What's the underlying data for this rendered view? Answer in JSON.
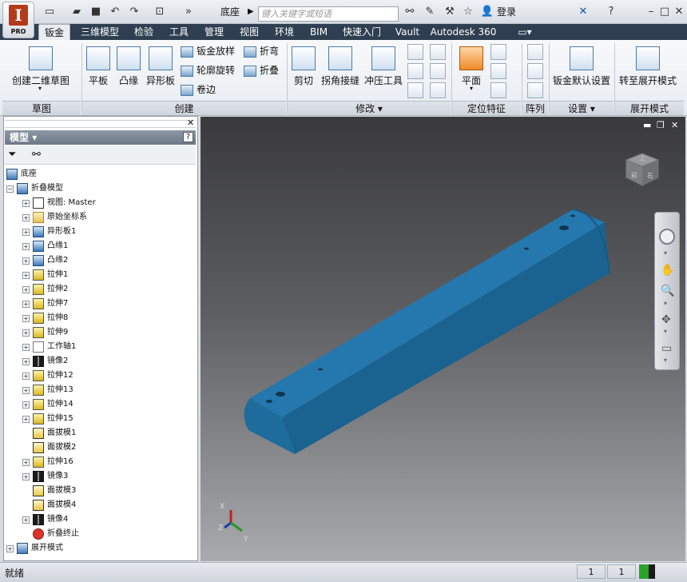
{
  "app": {
    "badge": "PRO",
    "logo_letter": "I"
  },
  "title_bar": {
    "document_name": "底座",
    "search_placeholder": "键入关键字或短语",
    "login_label": "登录"
  },
  "tabs": [
    {
      "label": "钣金",
      "active": true
    },
    {
      "label": "三维模型"
    },
    {
      "label": "检验"
    },
    {
      "label": "工具"
    },
    {
      "label": "管理"
    },
    {
      "label": "视图"
    },
    {
      "label": "环境"
    },
    {
      "label": "BIM"
    },
    {
      "label": "快速入门"
    },
    {
      "label": "Vault"
    },
    {
      "label": "Autodesk 360"
    }
  ],
  "ribbon": {
    "sketch": {
      "title": "草图",
      "create_sketch": "创建二维草图"
    },
    "create": {
      "title": "创建",
      "face": "平板",
      "flange": "凸缘",
      "contour_flange": "异形板",
      "lofted_flange": "钣金放样",
      "contour_roll": "轮廓旋转",
      "hem": "卷边",
      "fold": "折弯",
      "fold2": "折叠"
    },
    "modify": {
      "title": "修改",
      "cut": "剪切",
      "corner_seam": "拐角接缝",
      "punch_tool": "冲压工具"
    },
    "work_features": {
      "title": "定位特征",
      "plane": "平面"
    },
    "pattern": {
      "title": "阵列"
    },
    "setup": {
      "title": "设置",
      "sheet_metal_defaults": "钣金默认设置"
    },
    "flat_pattern": {
      "title": "展开模式",
      "go_to_flat_pattern": "转至展开模式"
    }
  },
  "browser": {
    "header": "模型",
    "help": "?",
    "items": [
      {
        "label": "底座",
        "icon": "part-icon"
      },
      {
        "label": "折叠模型",
        "icon": "folded-model-icon"
      },
      {
        "label": "视图: Master",
        "icon": "view-icon"
      },
      {
        "label": "原始坐标系",
        "icon": "folder-icon"
      },
      {
        "label": "异形板1",
        "icon": "contour-flange-icon"
      },
      {
        "label": "凸缘1",
        "icon": "flange-icon"
      },
      {
        "label": "凸缘2",
        "icon": "flange-icon"
      },
      {
        "label": "拉伸1",
        "icon": "extrude-icon"
      },
      {
        "label": "拉伸2",
        "icon": "extrude-icon"
      },
      {
        "label": "拉伸7",
        "icon": "extrude-icon"
      },
      {
        "label": "拉伸8",
        "icon": "extrude-icon"
      },
      {
        "label": "拉伸9",
        "icon": "extrude-icon"
      },
      {
        "label": "工作轴1",
        "icon": "work-axis-icon"
      },
      {
        "label": "镜像2",
        "icon": "mirror-icon"
      },
      {
        "label": "拉伸12",
        "icon": "extrude-icon"
      },
      {
        "label": "拉伸13",
        "icon": "extrude-icon"
      },
      {
        "label": "拉伸14",
        "icon": "extrude-icon"
      },
      {
        "label": "拉伸15",
        "icon": "extrude-icon"
      },
      {
        "label": "面拔模1",
        "icon": "face-draft-icon"
      },
      {
        "label": "面拔模2",
        "icon": "face-draft-icon"
      },
      {
        "label": "拉伸16",
        "icon": "extrude-icon"
      },
      {
        "label": "镜像3",
        "icon": "mirror-icon"
      },
      {
        "label": "面拔模3",
        "icon": "face-draft-icon"
      },
      {
        "label": "面拔模4",
        "icon": "face-draft-icon"
      },
      {
        "label": "镜像4",
        "icon": "mirror-icon"
      },
      {
        "label": "折叠终止",
        "icon": "end-of-folded-icon"
      },
      {
        "label": "展开模式",
        "icon": "flat-pattern-icon"
      }
    ]
  },
  "viewcube": {
    "face_top": "上",
    "face_front": "前",
    "face_right": "右"
  },
  "status_bar": {
    "status": "就绪",
    "count1": "1",
    "count2": "1"
  },
  "colors": {
    "model_blue": "#1f6f9e",
    "tab_bar": "#2f3e50",
    "accent_red": "#b33a1a"
  }
}
